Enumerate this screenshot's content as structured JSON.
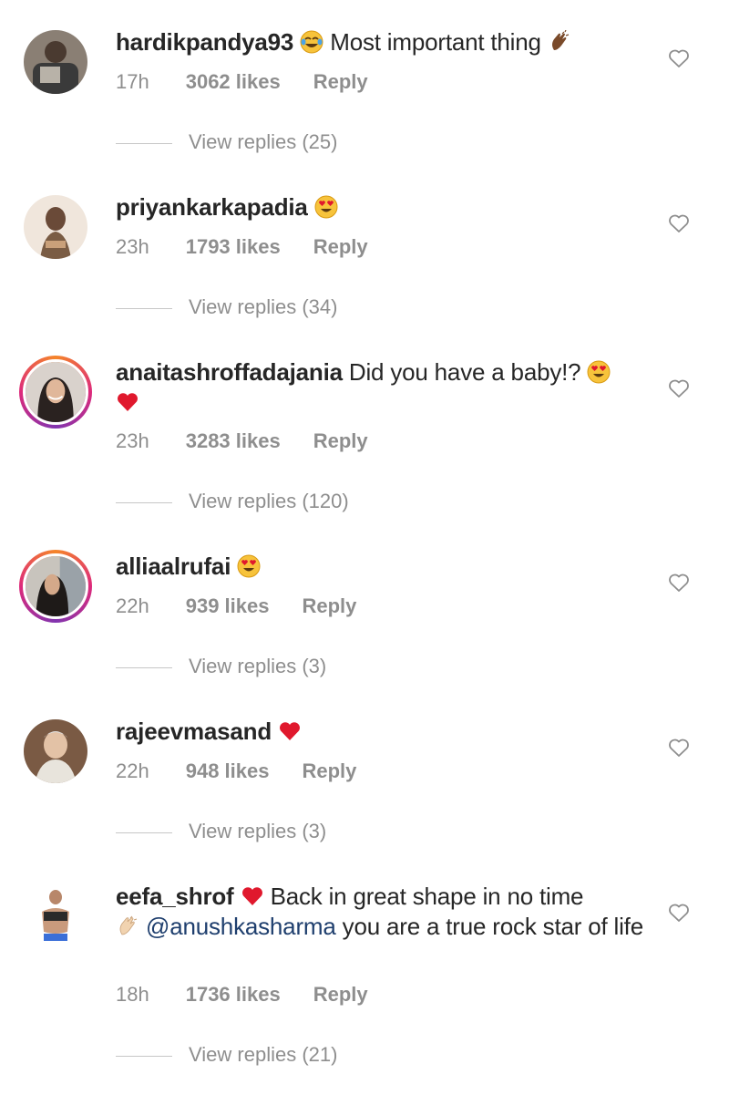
{
  "comments": [
    {
      "username": "hardikpandya93",
      "text_before": " ",
      "text": "Most important thing",
      "mention": "",
      "text_after": "",
      "emoji_icons": [
        "joy-emoji-icon",
        "clap-emoji-icon"
      ],
      "time": "17h",
      "likes": "3062 likes",
      "reply_label": "Reply",
      "view_replies": "View replies (25)"
    },
    {
      "username": "priyankarkapadia",
      "text": "",
      "emoji_icons": [
        "heart-eyes-emoji-icon"
      ],
      "time": "23h",
      "likes": "1793 likes",
      "reply_label": "Reply",
      "view_replies": "View replies (34)"
    },
    {
      "username": "anaitashroffadajania",
      "text": "Did you have a baby!?",
      "emoji_icons": [
        "heart-eyes-emoji-icon",
        "red-heart-emoji-icon"
      ],
      "time": "23h",
      "likes": "3283 likes",
      "reply_label": "Reply",
      "view_replies": "View replies (120)"
    },
    {
      "username": "alliaalrufai",
      "text": "",
      "emoji_icons": [
        "heart-eyes-emoji-icon"
      ],
      "time": "22h",
      "likes": "939 likes",
      "reply_label": "Reply",
      "view_replies": "View replies (3)"
    },
    {
      "username": "rajeevmasand",
      "text": "",
      "emoji_icons": [
        "red-heart-emoji-icon"
      ],
      "time": "22h",
      "likes": "948 likes",
      "reply_label": "Reply",
      "view_replies": "View replies (3)"
    },
    {
      "username": "eefa_shrof",
      "text": "Back in great shape in no time",
      "mention": "@anushkasharma",
      "text_after": "you are a true rock star of life",
      "emoji_icons": [
        "red-heart-emoji-icon",
        "clap-emoji-icon"
      ],
      "time": "18h",
      "likes": "1736 likes",
      "reply_label": "Reply",
      "view_replies": "View replies (21)"
    }
  ],
  "colors": {
    "text": "#262626",
    "secondary": "#8e8e8e",
    "mention": "#1f3f6e",
    "heart_red": "#e0182d"
  }
}
